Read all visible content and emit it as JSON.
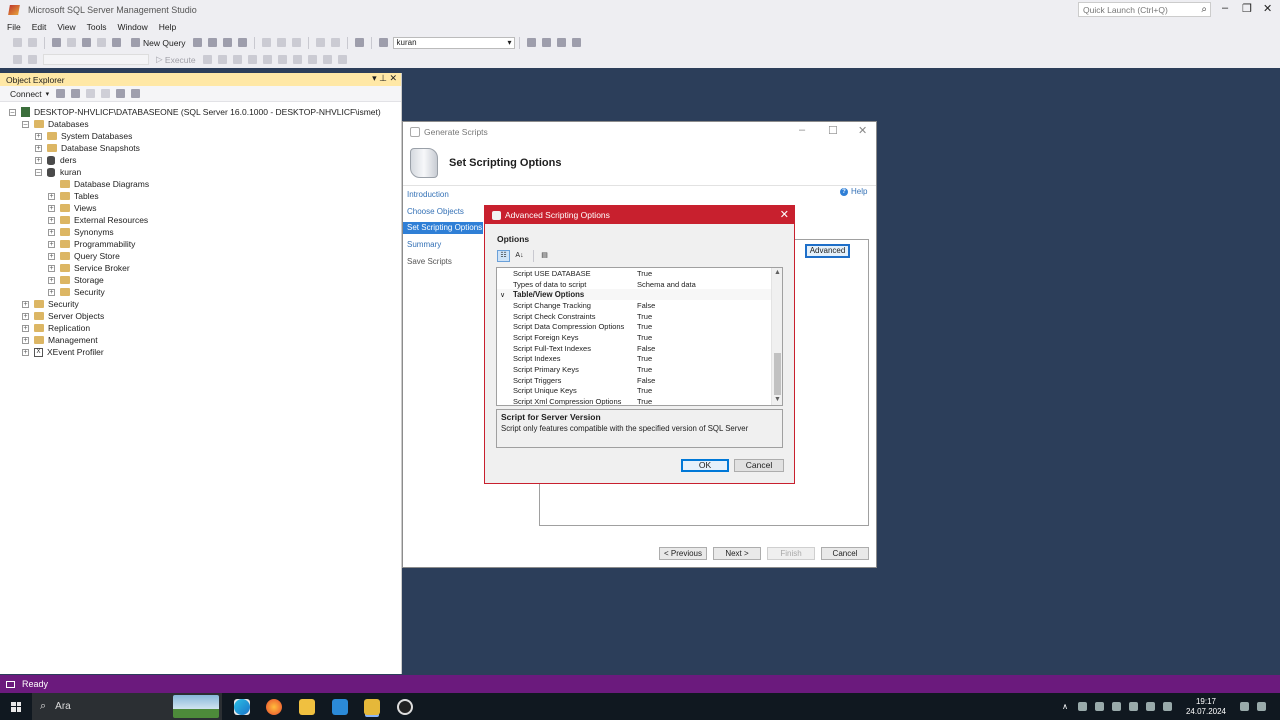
{
  "window": {
    "title": "Microsoft SQL Server Management Studio",
    "quick_launch": "Quick Launch (Ctrl+Q)"
  },
  "menu": [
    "File",
    "Edit",
    "View",
    "Tools",
    "Window",
    "Help"
  ],
  "toolbar": {
    "new_query": "New Query",
    "database": "kuran",
    "execute": "Execute"
  },
  "object_explorer": {
    "title": "Object Explorer",
    "connect": "Connect",
    "nodes": [
      {
        "label": "DESKTOP-NHVLICF\\DATABASEONE (SQL Server 16.0.1000 - DESKTOP-NHVLICF\\ismet)"
      },
      {
        "label": "Databases"
      },
      {
        "label": "System Databases"
      },
      {
        "label": "Database Snapshots"
      },
      {
        "label": "ders"
      },
      {
        "label": "kuran"
      },
      {
        "label": "Database Diagrams"
      },
      {
        "label": "Tables"
      },
      {
        "label": "Views"
      },
      {
        "label": "External Resources"
      },
      {
        "label": "Synonyms"
      },
      {
        "label": "Programmability"
      },
      {
        "label": "Query Store"
      },
      {
        "label": "Service Broker"
      },
      {
        "label": "Storage"
      },
      {
        "label": "Security"
      },
      {
        "label": "Security"
      },
      {
        "label": "Server Objects"
      },
      {
        "label": "Replication"
      },
      {
        "label": "Management"
      },
      {
        "label": "XEvent Profiler"
      }
    ]
  },
  "generate_scripts": {
    "title": "Generate Scripts",
    "heading": "Set Scripting Options",
    "nav": [
      "Introduction",
      "Choose Objects",
      "Set Scripting Options",
      "Summary",
      "Save Scripts"
    ],
    "help": "Help",
    "advanced": "Advanced",
    "previous": "< Previous",
    "next": "Next >",
    "finish": "Finish",
    "cancel": "Cancel"
  },
  "advanced_dialog": {
    "title": "Advanced Scripting Options",
    "options_label": "Options",
    "rows": [
      {
        "name": "Script USE DATABASE",
        "value": "True"
      },
      {
        "name": "Types of data to script",
        "value": "Schema and data"
      },
      {
        "name": "Table/View Options",
        "value": ""
      },
      {
        "name": "Script Change Tracking",
        "value": "False"
      },
      {
        "name": "Script Check Constraints",
        "value": "True"
      },
      {
        "name": "Script Data Compression Options",
        "value": "True"
      },
      {
        "name": "Script Foreign Keys",
        "value": "True"
      },
      {
        "name": "Script Full-Text Indexes",
        "value": "False"
      },
      {
        "name": "Script Indexes",
        "value": "True"
      },
      {
        "name": "Script Primary Keys",
        "value": "True"
      },
      {
        "name": "Script Triggers",
        "value": "False"
      },
      {
        "name": "Script Unique Keys",
        "value": "True"
      },
      {
        "name": "Script Xml Compression Options",
        "value": "True"
      }
    ],
    "desc_title": "Script for Server Version",
    "desc_text": "Script only features compatible with the specified version of SQL Server",
    "ok": "OK",
    "cancel": "Cancel"
  },
  "status": {
    "text": "Ready"
  },
  "taskbar": {
    "search": "Ara",
    "time": "19:17",
    "date": "24.07.2024"
  },
  "colors": {
    "dialog_accent": "#c8202e",
    "status_bar": "#6b1a7d",
    "selection": "#2f7fd6"
  }
}
